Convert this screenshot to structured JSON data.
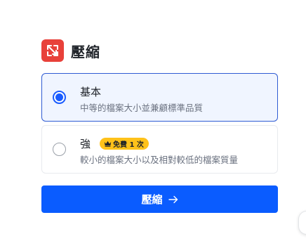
{
  "header": {
    "title": "壓縮",
    "icon": "compress-icon"
  },
  "options": [
    {
      "label": "基本",
      "description": "中等的檔案大小並兼顧標準品質",
      "checked": true
    },
    {
      "label": "強",
      "badge": "免費 1 次",
      "badge_icon": "crown-icon",
      "description": "較小的檔案大小以及相對較低的檔案質量",
      "checked": false
    }
  ],
  "submit": {
    "label": "壓縮",
    "icon": "arrow-right-icon"
  },
  "colors": {
    "accent": "#0a5cff",
    "tool_icon": "#e8413a",
    "badge": "#ffc21a",
    "selected_bg": "#f0f5ff"
  }
}
